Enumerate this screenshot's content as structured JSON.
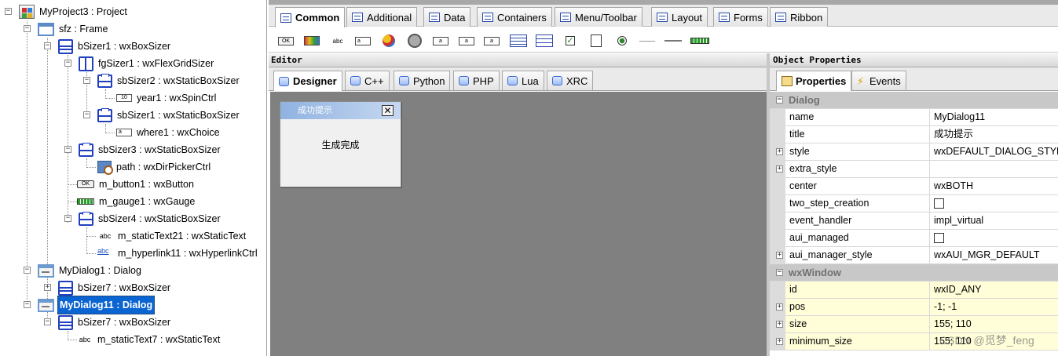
{
  "tree": {
    "items": [
      {
        "label": "MyProject3 : Project"
      },
      {
        "label": "sfz : Frame"
      },
      {
        "label": "bSizer1 : wxBoxSizer"
      },
      {
        "label": "fgSizer1 : wxFlexGridSizer"
      },
      {
        "label": "sbSizer2 : wxStaticBoxSizer"
      },
      {
        "label": "year1 : wxSpinCtrl"
      },
      {
        "label": "sbSizer1 : wxStaticBoxSizer"
      },
      {
        "label": "where1 : wxChoice"
      },
      {
        "label": "sbSizer3 : wxStaticBoxSizer"
      },
      {
        "label": "path : wxDirPickerCtrl"
      },
      {
        "label": "m_button1 : wxButton"
      },
      {
        "label": "m_gauge1 : wxGauge"
      },
      {
        "label": "sbSizer4 : wxStaticBoxSizer"
      },
      {
        "label": "m_staticText21 : wxStaticText"
      },
      {
        "label": "m_hyperlink11 : wxHyperlinkCtrl"
      },
      {
        "label": "MyDialog1 : Dialog"
      },
      {
        "label": "bSizer7 : wxBoxSizer"
      },
      {
        "label": "MyDialog11 : Dialog"
      },
      {
        "label": "bSizer7 : wxBoxSizer"
      },
      {
        "label": "m_staticText7 : wxStaticText"
      }
    ],
    "project_icon_text": "wxForm",
    "spin_icon_text": "10",
    "choice_icon_text": "a",
    "button_icon_text": "OK",
    "text_icon_text": "abc",
    "link_icon_text": "abc"
  },
  "palette": {
    "tabs": [
      "Common",
      "Additional",
      "Data",
      "Containers",
      "Menu/Toolbar",
      "Layout",
      "Forms",
      "Ribbon"
    ],
    "active_tab": "Common",
    "icon_texts": {
      "button": "OK",
      "text": "abc",
      "textctrl": "a",
      "combo": "a",
      "choice": "a"
    }
  },
  "editor": {
    "caption": "Editor",
    "tabs": [
      "Designer",
      "C++",
      "Python",
      "PHP",
      "Lua",
      "XRC"
    ],
    "active_tab": "Designer",
    "dialog": {
      "title": "成功提示",
      "close": "✕",
      "body_text": "生成完成"
    }
  },
  "properties": {
    "caption": "Object Properties",
    "tabs": [
      "Properties",
      "Events"
    ],
    "active_tab": "Properties",
    "events_icon": "⚡",
    "rows": [
      {
        "type": "category",
        "expander": "−",
        "name": "Dialog"
      },
      {
        "name": "name",
        "value": "MyDialog11"
      },
      {
        "name": "title",
        "value": "成功提示"
      },
      {
        "expander": "+",
        "name": "style",
        "value": "wxDEFAULT_DIALOG_STYLE"
      },
      {
        "expander": "+",
        "name": "extra_style",
        "value": ""
      },
      {
        "name": "center",
        "value": "wxBOTH"
      },
      {
        "name": "two_step_creation",
        "checkbox": true
      },
      {
        "name": "event_handler",
        "value": "impl_virtual"
      },
      {
        "name": "aui_managed",
        "checkbox": true
      },
      {
        "expander": "+",
        "name": "aui_manager_style",
        "value": "wxAUI_MGR_DEFAULT"
      },
      {
        "type": "category",
        "expander": "−",
        "name": "wxWindow"
      },
      {
        "name": "id",
        "value": "wxID_ANY",
        "highlight": true
      },
      {
        "expander": "+",
        "name": "pos",
        "value": "-1; -1",
        "highlight": true
      },
      {
        "expander": "+",
        "name": "size",
        "value": "155; 110",
        "highlight": true
      },
      {
        "expander": "+",
        "name": "minimum_size",
        "value": "155; 110",
        "highlight": true
      }
    ]
  },
  "watermark": "CSDN @觅梦_feng",
  "colors": {
    "selection": "#0a64d2",
    "designer_bg": "#808080",
    "highlight_row": "#fffed8",
    "category_row": "#c8c8c8"
  }
}
